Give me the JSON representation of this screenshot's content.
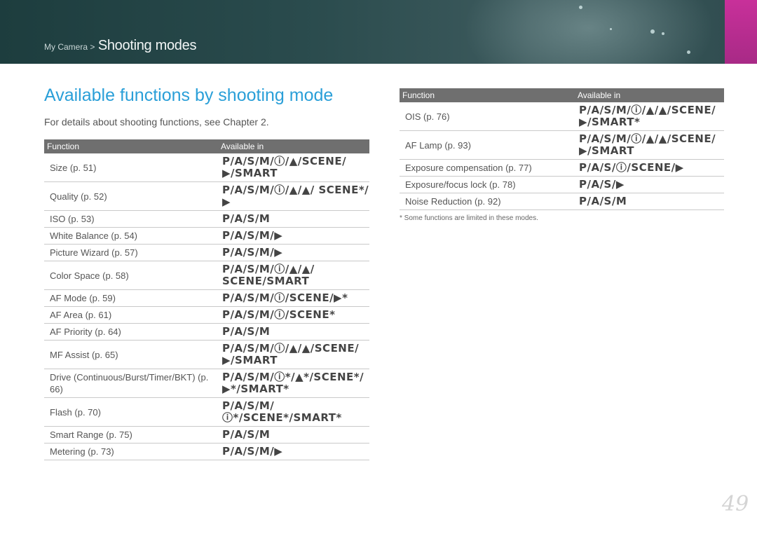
{
  "header": {
    "breadcrumb_parent": "My Camera >",
    "breadcrumb_current": "Shooting modes",
    "accent_color": "#c8309a"
  },
  "title": "Available functions by shooting mode",
  "intro": "For details about shooting functions, see Chapter 2.",
  "table_headers": {
    "function": "Function",
    "available": "Available in"
  },
  "left_rows": [
    {
      "function": "Size (p. 51)",
      "available": "P/A/S/M/ⓘ/▲/SCENE/ ▶/SMART"
    },
    {
      "function": "Quality (p. 52)",
      "available": "P/A/S/M/ⓘ/▲/▲/ SCENE*/▶"
    },
    {
      "function": "ISO (p. 53)",
      "available": "P/A/S/M"
    },
    {
      "function": "White Balance (p. 54)",
      "available": "P/A/S/M/▶"
    },
    {
      "function": "Picture Wizard (p. 57)",
      "available": "P/A/S/M/▶"
    },
    {
      "function": "Color Space (p. 58)",
      "available": "P/A/S/M/ⓘ/▲/▲/ SCENE/SMART"
    },
    {
      "function": "AF Mode (p. 59)",
      "available": "P/A/S/M/ⓘ/SCENE/▶*"
    },
    {
      "function": "AF Area (p. 61)",
      "available": "P/A/S/M/ⓘ/SCENE*"
    },
    {
      "function": "AF Priority (p. 64)",
      "available": "P/A/S/M"
    },
    {
      "function": "MF Assist (p. 65)",
      "available": "P/A/S/M/ⓘ/▲/▲/SCENE/ ▶/SMART"
    },
    {
      "function": "Drive (Continuous/Burst/Timer/BKT) (p. 66)",
      "available": "P/A/S/M/ⓘ*/▲*/SCENE*/ ▶*/SMART*"
    },
    {
      "function": "Flash (p. 70)",
      "available": "P/A/S/M/ⓘ*/SCENE*/SMART*"
    },
    {
      "function": "Smart Range (p. 75)",
      "available": "P/A/S/M"
    },
    {
      "function": "Metering (p. 73)",
      "available": "P/A/S/M/▶"
    }
  ],
  "right_rows": [
    {
      "function": "OIS (p. 76)",
      "available": "P/A/S/M/ⓘ/▲/▲/SCENE/ ▶/SMART*"
    },
    {
      "function": "AF Lamp (p. 93)",
      "available": "P/A/S/M/ⓘ/▲/▲/SCENE/ ▶/SMART"
    },
    {
      "function": "Exposure compensation (p. 77)",
      "available": "P/A/S/ⓘ/SCENE/▶"
    },
    {
      "function": "Exposure/focus lock (p. 78)",
      "available": "P/A/S/▶"
    },
    {
      "function": "Noise Reduction (p. 92)",
      "available": "P/A/S/M"
    }
  ],
  "footnote": "* Some functions are limited in these modes.",
  "page_number": "49"
}
